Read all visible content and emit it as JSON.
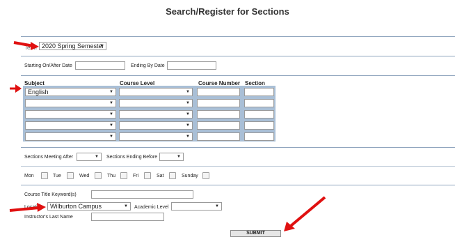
{
  "page_title": "Search/Register for Sections",
  "term": {
    "label": "Term",
    "value": "2020 Spring Semester"
  },
  "dates": {
    "start_label": "Starting On/After Date",
    "start_value": "",
    "end_label": "Ending By Date",
    "end_value": ""
  },
  "grid": {
    "headers": {
      "subject": "Subject",
      "level": "Course Level",
      "number": "Course Number",
      "section": "Section"
    },
    "rows": [
      {
        "subject": "English",
        "level": "",
        "number": "",
        "section": ""
      },
      {
        "subject": "",
        "level": "",
        "number": "",
        "section": ""
      },
      {
        "subject": "",
        "level": "",
        "number": "",
        "section": ""
      },
      {
        "subject": "",
        "level": "",
        "number": "",
        "section": ""
      },
      {
        "subject": "",
        "level": "",
        "number": "",
        "section": ""
      }
    ]
  },
  "times": {
    "after_label": "Sections Meeting After",
    "after_value": "",
    "before_label": "Sections Ending Before",
    "before_value": ""
  },
  "days": [
    "Mon",
    "Tue",
    "Wed",
    "Thu",
    "Fri",
    "Sat",
    "Sunday"
  ],
  "keyword": {
    "label": "Course Title Keyword(s)",
    "value": ""
  },
  "location": {
    "label": "Location",
    "value": "Wilburton Campus"
  },
  "academic_level": {
    "label": "Academic Level",
    "value": ""
  },
  "instructor": {
    "label": "Instructor's Last Name",
    "value": ""
  },
  "submit_label": "SUBMIT",
  "colors": {
    "accent": "#a9bfd6",
    "arrow": "#e01010",
    "divider": "#8ea4bd"
  },
  "icons": [
    "dropdown-arrow-icon",
    "red-pointer-arrow-icon"
  ]
}
